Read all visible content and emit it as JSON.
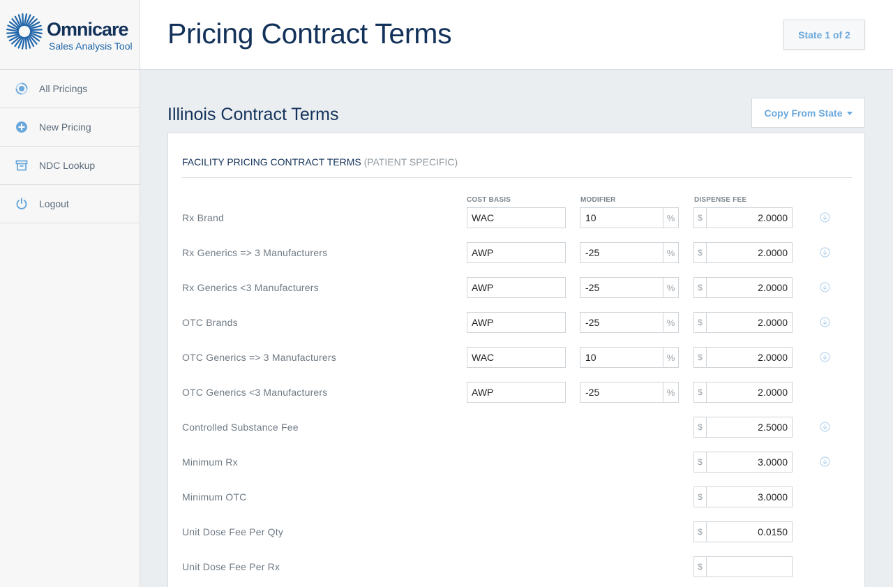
{
  "brand": {
    "name": "Omnicare",
    "subtitle": "Sales Analysis Tool",
    "accent": "#13325a",
    "link": "#6aa8dc"
  },
  "sidebar": {
    "items": [
      {
        "label": "All Pricings",
        "icon": "target-icon"
      },
      {
        "label": "New Pricing",
        "icon": "plus-circle-icon"
      },
      {
        "label": "NDC Lookup",
        "icon": "archive-box-icon"
      },
      {
        "label": "Logout",
        "icon": "power-icon"
      }
    ]
  },
  "header": {
    "title": "Pricing Contract Terms",
    "state_label": "State 1 of 2"
  },
  "main": {
    "section_title": "Illinois Contract Terms",
    "copy_button": "Copy From State",
    "panel_title": "FACILITY PRICING CONTRACT TERMS",
    "panel_subtitle": "(PATIENT SPECIFIC)",
    "columns": {
      "cost_basis": "COST BASIS",
      "modifier": "MODIFIER",
      "dispense_fee": "DISPENSE FEE"
    },
    "percent_symbol": "%",
    "currency_symbol": "$",
    "rows": [
      {
        "label": "Rx Brand",
        "cost_basis": "WAC",
        "modifier": "10",
        "fee": "2.0000",
        "copy_down": true
      },
      {
        "label": "Rx Generics => 3 Manufacturers",
        "cost_basis": "AWP",
        "modifier": "-25",
        "fee": "2.0000",
        "copy_down": true
      },
      {
        "label": "Rx Generics <3 Manufacturers",
        "cost_basis": "AWP",
        "modifier": "-25",
        "fee": "2.0000",
        "copy_down": true
      },
      {
        "label": "OTC Brands",
        "cost_basis": "AWP",
        "modifier": "-25",
        "fee": "2.0000",
        "copy_down": true
      },
      {
        "label": "OTC Generics => 3 Manufacturers",
        "cost_basis": "WAC",
        "modifier": "10",
        "fee": "2.0000",
        "copy_down": true
      },
      {
        "label": "OTC Generics <3 Manufacturers",
        "cost_basis": "AWP",
        "modifier": "-25",
        "fee": "2.0000",
        "copy_down": false
      },
      {
        "label": "Controlled Substance Fee",
        "fee": "2.5000",
        "copy_down": true
      },
      {
        "label": "Minimum Rx",
        "fee": "3.0000",
        "copy_down": true
      },
      {
        "label": "Minimum OTC",
        "fee": "3.0000",
        "copy_down": false
      },
      {
        "label": "Unit Dose Fee Per Qty",
        "fee": "0.0150",
        "copy_down": false
      },
      {
        "label": "Unit Dose Fee Per Rx",
        "fee": "",
        "copy_down": false
      }
    ]
  }
}
